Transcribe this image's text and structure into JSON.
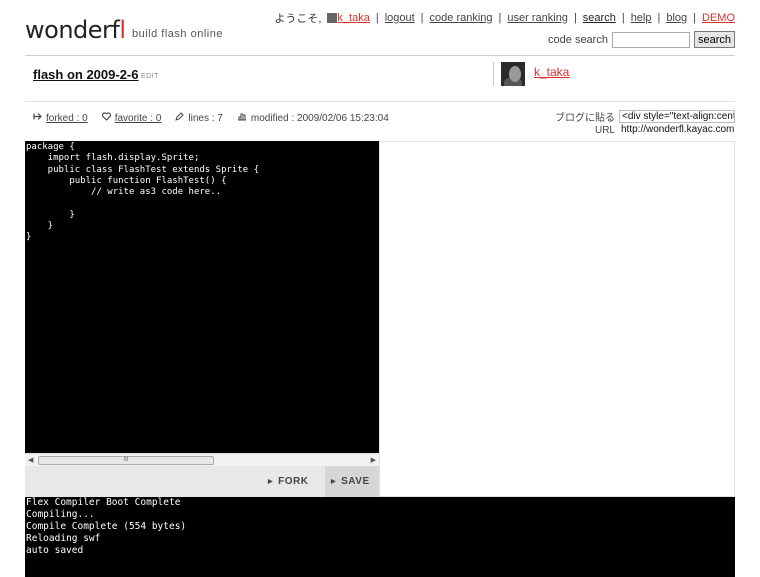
{
  "header": {
    "logo_main": "wonderf",
    "logo_accent": "l",
    "tagline": "build flash online",
    "welcome": "ようこそ,",
    "username": "k_taka",
    "nav": {
      "logout": "logout",
      "code_ranking": "code ranking",
      "user_ranking": "user ranking",
      "search": "search",
      "help": "help",
      "blog": "blog",
      "demo": "DEMO"
    },
    "separator": "|",
    "code_search_label": "code search",
    "code_search_value": "",
    "search_button": "search"
  },
  "code": {
    "title": "flash on 2009-2-6",
    "edit_label": "EDIT",
    "author": "k_taka",
    "forked": "forked : 0",
    "favorite": "favorite : 0",
    "lines": "lines : 7",
    "modified": "modified : 2009/02/06 15:23:04",
    "blog_embed_label": "ブログに貼る",
    "blog_embed_value": "<div style=\"text-align:cent",
    "url_label": "URL",
    "url_value": "http://wonderfl.kayac.com"
  },
  "editor": {
    "source": "package {\n    import flash.display.Sprite;\n    public class FlashTest extends Sprite {\n        public function FlashTest() {\n            // write as3 code here..\n\n        }\n    }\n}",
    "scroll_thumb": "III"
  },
  "actions": {
    "fork": "FORK",
    "save": "SAVE"
  },
  "console": {
    "output": "Flex Compiler Boot Complete\nCompiling...\nCompile Complete (554 bytes)\nReloading swf\nauto saved"
  },
  "icons": {
    "forked": "fork-icon",
    "favorite": "heart-icon",
    "lines": "pencil-icon",
    "modified": "clock-icon"
  },
  "colors": {
    "accent": "#d9342b",
    "editor_bg": "#000000",
    "editor_text": "#ffffff"
  }
}
